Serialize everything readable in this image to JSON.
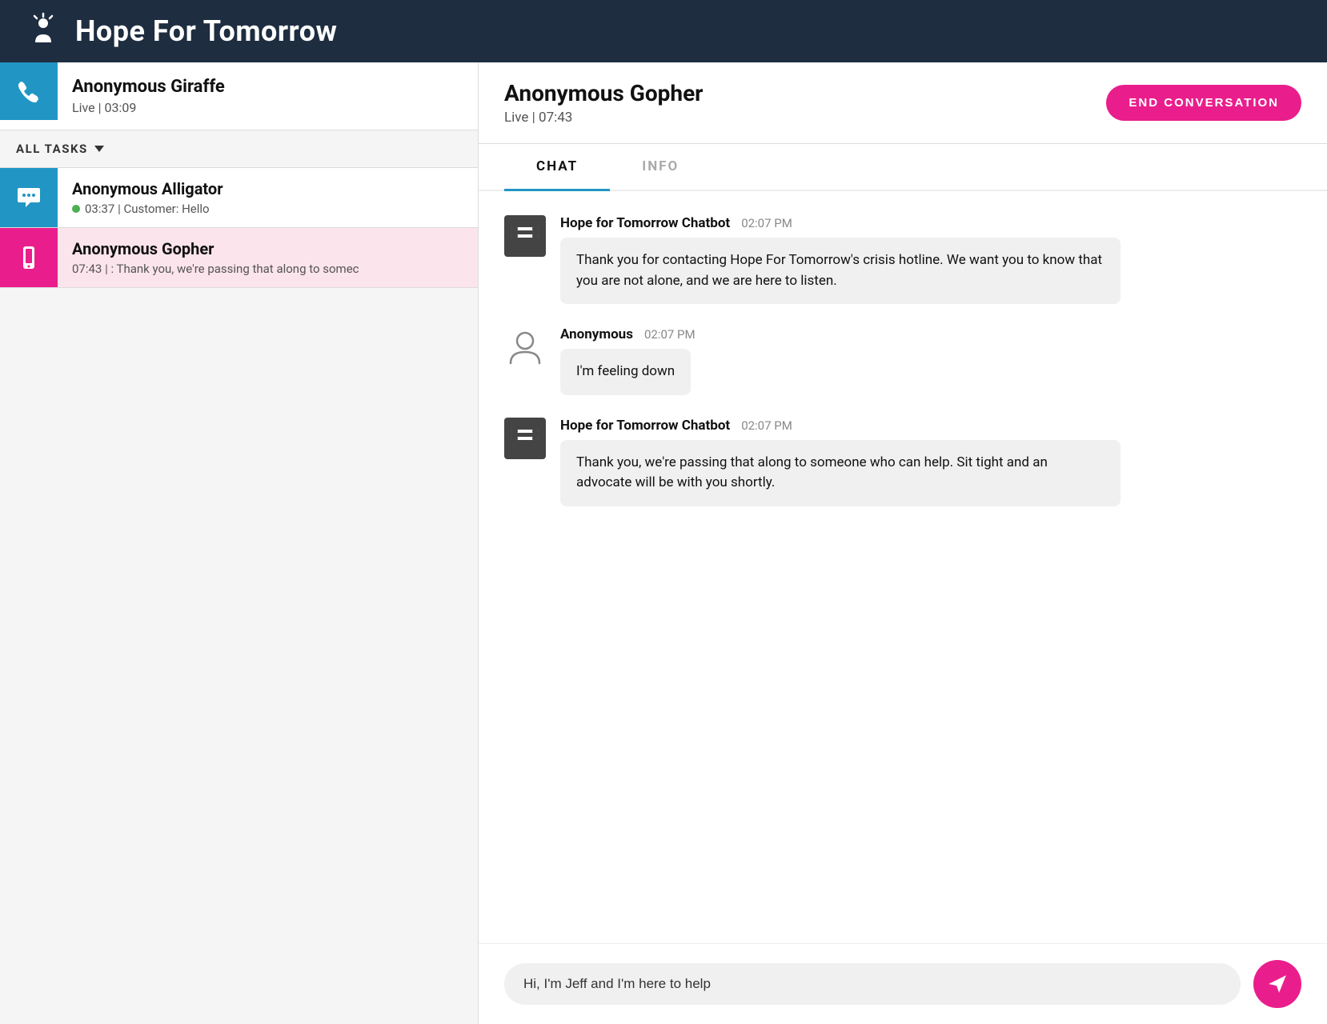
{
  "header": {
    "title": "Hope For Tomorrow",
    "icon_alt": "hope-logo"
  },
  "sidebar": {
    "pinned_contact": {
      "name": "Anonymous Giraffe",
      "status": "Live | 03:09",
      "icon_type": "phone"
    },
    "all_tasks_label": "ALL TASKS",
    "contacts": [
      {
        "id": "alligator",
        "name": "Anonymous Alligator",
        "preview": "03:37 | Customer: Hello",
        "icon_type": "chat",
        "has_dot": true,
        "color": "teal"
      },
      {
        "id": "gopher",
        "name": "Anonymous Gopher",
        "preview": "07:43 | : Thank you, we're passing that along to somec",
        "icon_type": "mobile",
        "has_dot": false,
        "color": "pink"
      }
    ]
  },
  "chat_panel": {
    "contact_name": "Anonymous Gopher",
    "contact_status": "Live | 07:43",
    "end_conversation_label": "END CONVERSATION",
    "tabs": [
      {
        "id": "chat",
        "label": "CHAT",
        "active": true
      },
      {
        "id": "info",
        "label": "INFO",
        "active": false
      }
    ],
    "messages": [
      {
        "id": "msg1",
        "sender": "Hope for Tomorrow Chatbot",
        "time": "02:07 PM",
        "text": "Thank you for contacting Hope For Tomorrow's crisis hotline. We want you to know that you are not alone, and we are here to listen.",
        "type": "bot"
      },
      {
        "id": "msg2",
        "sender": "Anonymous",
        "time": "02:07 PM",
        "text": "I'm feeling down",
        "type": "user"
      },
      {
        "id": "msg3",
        "sender": "Hope for Tomorrow Chatbot",
        "time": "02:07 PM",
        "text": "Thank you, we're passing that along to someone who can help. Sit tight and an advocate will be with you shortly.",
        "type": "bot"
      }
    ],
    "input_placeholder": "Hi, I'm Jeff and I'm here to help",
    "send_label": "send"
  }
}
